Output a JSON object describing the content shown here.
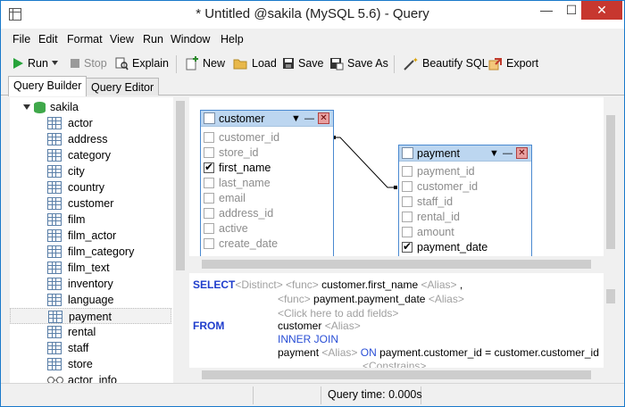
{
  "window": {
    "title": "* Untitled @sakila (MySQL 5.6) - Query",
    "min": "—",
    "max": "☐",
    "close": "✕"
  },
  "menu": [
    "File",
    "Edit",
    "Format",
    "View",
    "Run",
    "Window",
    "Help"
  ],
  "toolbar": {
    "run": "Run",
    "stop": "Stop",
    "explain": "Explain",
    "new": "New",
    "load": "Load",
    "save": "Save",
    "save_as": "Save As",
    "beautify": "Beautify SQL",
    "export": "Export"
  },
  "tabs": [
    "Query Builder",
    "Query Editor"
  ],
  "tree": {
    "database": "sakila",
    "tables": [
      "actor",
      "address",
      "category",
      "city",
      "country",
      "customer",
      "film",
      "film_actor",
      "film_category",
      "film_text",
      "inventory",
      "language",
      "payment",
      "rental",
      "staff",
      "store",
      "actor_info"
    ],
    "selected": "payment"
  },
  "diagram": {
    "customer": {
      "name": "customer",
      "fields": [
        {
          "name": "customer_id",
          "checked": false
        },
        {
          "name": "store_id",
          "checked": false
        },
        {
          "name": "first_name",
          "checked": true
        },
        {
          "name": "last_name",
          "checked": false
        },
        {
          "name": "email",
          "checked": false
        },
        {
          "name": "address_id",
          "checked": false
        },
        {
          "name": "active",
          "checked": false
        },
        {
          "name": "create_date",
          "checked": false
        }
      ]
    },
    "payment": {
      "name": "payment",
      "fields": [
        {
          "name": "payment_id",
          "checked": false
        },
        {
          "name": "customer_id",
          "checked": false
        },
        {
          "name": "staff_id",
          "checked": false
        },
        {
          "name": "rental_id",
          "checked": false
        },
        {
          "name": "amount",
          "checked": false
        },
        {
          "name": "payment_date",
          "checked": true
        }
      ]
    }
  },
  "sql": {
    "select_kw": "SELECT",
    "distinct": "<Distinct>",
    "func1": "<func>",
    "field1": "customer.first_name",
    "alias1": "<Alias>",
    "comma": ",",
    "func2": "<func>",
    "field2": "payment.payment_date",
    "alias2": "<Alias>",
    "add_fields": "<Click here to add fields>",
    "from_kw": "FROM",
    "table1": "customer",
    "alias3": "<Alias>",
    "join": "INNER JOIN",
    "table2": "payment",
    "alias4": "<Alias>",
    "on_kw": "ON",
    "condition": "payment.customer_id = customer.customer_id",
    "constrains": "<Constrains>"
  },
  "status": {
    "query_time": "Query time: 0.000s"
  }
}
